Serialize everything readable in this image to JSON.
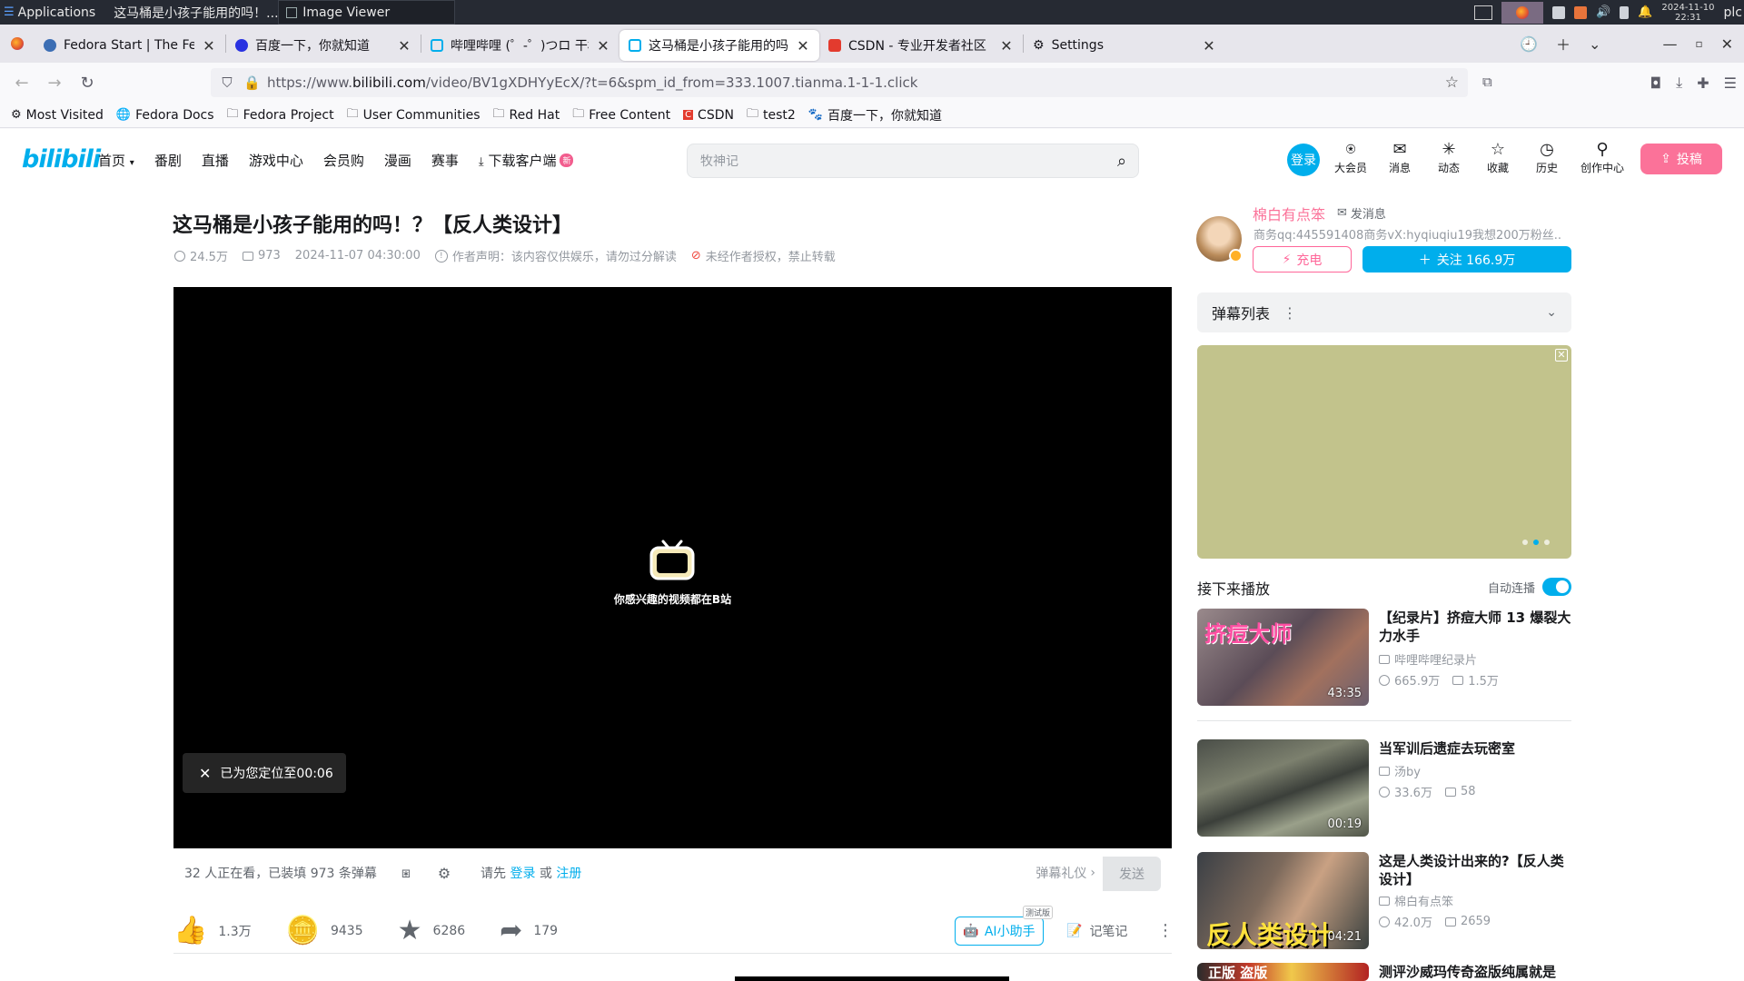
{
  "system_panel": {
    "apps_label": "Applications",
    "task1_title": "这马桶是小孩子能用的吗！...",
    "task2_title": "Image Viewer",
    "clock_date": "2024-11-10",
    "clock_time": "22:31",
    "user": "plc"
  },
  "browser": {
    "tabs": [
      {
        "title": "Fedora Start | The Fedora",
        "icon": "fedora-icon"
      },
      {
        "title": "百度一下，你就知道",
        "icon": "baidu-paw-icon"
      },
      {
        "title": "哔哩哔哩 (゜-゜)つロ 干杯~",
        "icon": "bilibili-tv-icon"
      },
      {
        "title": "这马桶是小孩子能用的吗！？",
        "icon": "bilibili-tv-icon",
        "active": true
      },
      {
        "title": "CSDN - 专业开发者社区",
        "icon": "csdn-icon"
      },
      {
        "title": "Settings",
        "icon": "gear-icon"
      }
    ],
    "url_prefix": "https://www.",
    "url_domain": "bilibili.com",
    "url_path": "/video/BV1gXDHYyEcX/?t=6&spm_id_from=333.1007.tianma.1-1-1.click",
    "bookmarks": [
      {
        "label": "Most Visited",
        "icon": "gear-icon"
      },
      {
        "label": "Fedora Docs",
        "icon": "globe-icon"
      },
      {
        "label": "Fedora Project",
        "icon": "folder-icon"
      },
      {
        "label": "User Communities",
        "icon": "folder-icon"
      },
      {
        "label": "Red Hat",
        "icon": "folder-icon"
      },
      {
        "label": "Free Content",
        "icon": "folder-icon"
      },
      {
        "label": "CSDN",
        "icon": "csdn-icon"
      },
      {
        "label": "test2",
        "icon": "folder-icon"
      },
      {
        "label": "百度一下，你就知道",
        "icon": "baidu-paw-icon"
      }
    ]
  },
  "bili_header": {
    "logo": "bilibili",
    "nav": [
      "首页",
      "番剧",
      "直播",
      "游戏中心",
      "会员购",
      "漫画",
      "赛事"
    ],
    "download_label": "下载客户端",
    "new_badge": "新",
    "search_placeholder": "牧神记",
    "login_label": "登录",
    "icons": [
      {
        "label": "大会员",
        "icon": "vip-icon"
      },
      {
        "label": "消息",
        "icon": "message-icon"
      },
      {
        "label": "动态",
        "icon": "dynamic-icon"
      },
      {
        "label": "收藏",
        "icon": "favorite-icon"
      },
      {
        "label": "历史",
        "icon": "history-icon"
      },
      {
        "label": "创作中心",
        "icon": "creator-icon"
      }
    ],
    "upload_label": "投稿"
  },
  "video": {
    "title": "这马桶是小孩子能用的吗！？【反人类设计】",
    "views": "24.5万",
    "danmaku_count": "973",
    "publish_time": "2024-11-07 04:30:00",
    "author_statement": "作者声明：该内容仅供娱乐，请勿过分解读",
    "no_repost": "未经作者授权，禁止转载",
    "player_caption": "你感兴趣的视频都在B站",
    "toast": "已为您定位至00:06",
    "viewers_text": "32 人正在看，已装填 973 条弹幕",
    "login_prompt": "请先",
    "login_link": "登录",
    "or": "或",
    "register_link": "注册",
    "etiquette": "弹幕礼仪",
    "send": "发送",
    "likes": "1.3万",
    "coins": "9435",
    "favorites": "6286",
    "shares": "179",
    "ai_label": "AI小助手",
    "ai_beta": "测试版",
    "notes_label": "记笔记"
  },
  "uploader": {
    "name": "棉白有点笨",
    "message": "发消息",
    "desc": "商务qq:445591408商务vX:hyqiuqiu19我想200万粉丝...",
    "charge": "充电",
    "follow": "关注 166.9万"
  },
  "sidebar": {
    "danmaku_list": "弹幕列表",
    "next_up": "接下来播放",
    "autoplay": "自动连播",
    "autoplay_on": true,
    "recommendations": [
      {
        "title": "【纪录片】挤痘大师 13 爆裂大力水手",
        "author": "哔哩哔哩纪录片",
        "views": "665.9万",
        "danmaku": "1.5万",
        "duration": "43:35",
        "thumb_text": "挤痘大师"
      },
      {
        "title": "当军训后遗症去玩密室",
        "author": "汤by",
        "views": "33.6万",
        "danmaku": "58",
        "duration": "00:19",
        "thumb_text": ""
      },
      {
        "title": "这是人类设计出来的?【反人类设计】",
        "author": "棉白有点笨",
        "views": "42.0万",
        "danmaku": "2659",
        "duration": "04:21",
        "thumb_text": "反人类设计"
      },
      {
        "title": "测评沙威玛传奇盗版纯属就是",
        "author": "",
        "views": "",
        "danmaku": "",
        "duration": "",
        "thumb_text": "正版 盗版"
      }
    ]
  },
  "colors": {
    "bili_blue": "#00aeec",
    "bili_pink": "#fb7299",
    "ad_bg": "#c2c38c"
  }
}
